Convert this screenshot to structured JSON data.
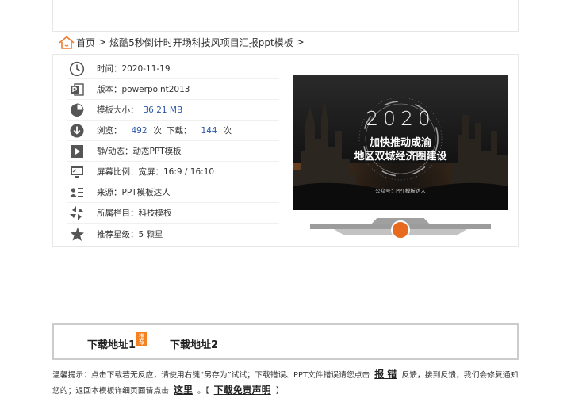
{
  "breadcrumb": {
    "home": "首页",
    "separator": ">",
    "current": "炫酷5秒倒计时开场科技风项目汇报ppt模板"
  },
  "meta": {
    "time_label": "时间：",
    "time_value": "2020-11-19",
    "version_label": "版本：",
    "version_value": "powerpoint2013",
    "size_label": "模板大小：",
    "size_value": "36.21 MB",
    "views_label": "浏览：",
    "views_value": "492",
    "times_unit": "次",
    "downloads_label": "下载：",
    "downloads_value": "144",
    "type_label": "静/动态：",
    "type_value": "动态PPT模板",
    "ratio_label": "屏幕比例：",
    "ratio_value": "宽屏：16:9 / 16:10",
    "source_label": "来源：",
    "source_value": "PPT模板达人",
    "column_label": "所属栏目：",
    "column_value": "科技模板",
    "rating_label": "推荐星级：",
    "rating_value": "5 颗星"
  },
  "preview": {
    "year": "2020",
    "line1": "加快推动成渝",
    "line2": "地区双城经济圈建设",
    "footer": "公众号：PPT模板达人"
  },
  "download": {
    "link1": "下载地址1",
    "badge": "推荐",
    "link2": "下载地址2"
  },
  "tip": {
    "text1": "温馨提示：点击下载若无反应，请使用右键“另存为”试试；下载错误、PPT文件错误请您点击",
    "report_link": "报 错",
    "text2": "反馈，接到反馈，我们会修复通知您的；返回本模板详细页面请点击",
    "here_link": "这里",
    "text3": "。【",
    "disclaimer_link": "下载免责声明",
    "text4": "】"
  },
  "colors": {
    "accent_blue": "#2d57a8",
    "badge_orange": "#f58220",
    "icon_gray": "#555555"
  }
}
